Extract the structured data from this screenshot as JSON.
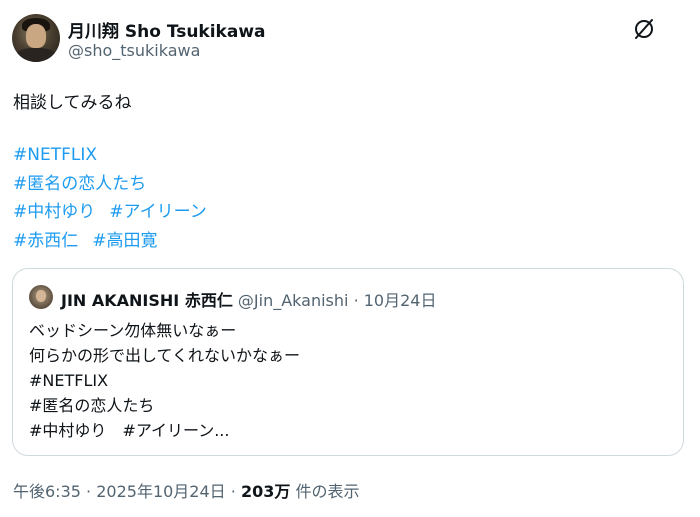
{
  "author": {
    "display_name": "月川翔 Sho Tsukikawa",
    "handle": "@sho_tsukikawa"
  },
  "tweet": {
    "text": "相談してみるね",
    "hashtag_lines": [
      [
        "#NETFLIX"
      ],
      [
        "#匿名の恋人たち"
      ],
      [
        "#中村ゆり",
        "#アイリーン"
      ],
      [
        "#赤西仁",
        "#高田寛"
      ]
    ]
  },
  "quote": {
    "display_name": "JIN AKANISHI 赤西仁",
    "handle": "@Jin_Akanishi",
    "separator": "·",
    "date": "10月24日",
    "lines": [
      "ベッドシーン勿体無いなぁー",
      "何らかの形で出してくれないかなぁー",
      "#NETFLIX",
      "#匿名の恋人たち",
      "#中村ゆり　#アイリーン..."
    ]
  },
  "meta": {
    "time": "午後6:35",
    "sep1": "·",
    "date": "2025年10月24日",
    "sep2": "·",
    "views_count": "203万",
    "views_label": "件の表示"
  },
  "colors": {
    "hashtag": "#1d9bf0",
    "text": "#0f1419",
    "secondary": "#536471",
    "border": "#cfd9de"
  },
  "icons": {
    "more": "grok-slash-icon"
  }
}
